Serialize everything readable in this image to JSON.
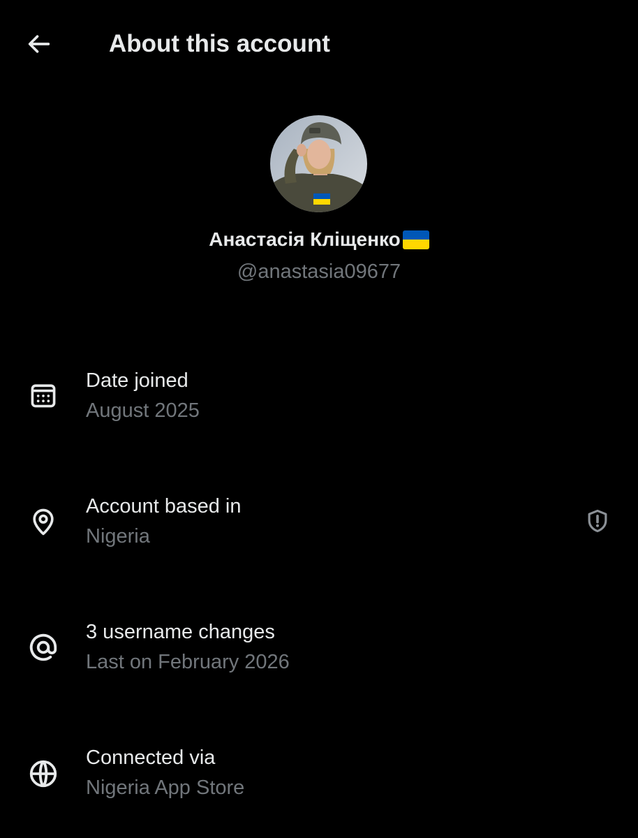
{
  "header": {
    "title": "About this account",
    "back_icon": "arrow-left-icon"
  },
  "profile": {
    "display_name": "Анастасія Кліщенко",
    "flag": "flag-ukraine-emoji",
    "handle": "@anastasia09677",
    "avatar": "profile-photo"
  },
  "rows": [
    {
      "icon": "calendar-icon",
      "label": "Date joined",
      "value": "August 2025"
    },
    {
      "icon": "location-pin-icon",
      "label": "Account based in",
      "value": "Nigeria",
      "trailing_icon": "shield-alert-icon"
    },
    {
      "icon": "at-sign-icon",
      "label": "3 username changes",
      "value": "Last on February 2026"
    },
    {
      "icon": "globe-icon",
      "label": "Connected via",
      "value": "Nigeria App Store"
    }
  ],
  "colors": {
    "background": "#000000",
    "primary_text": "#e7e9ea",
    "secondary_text": "#71767b",
    "flag_blue": "#0057b7",
    "flag_yellow": "#ffd700"
  }
}
